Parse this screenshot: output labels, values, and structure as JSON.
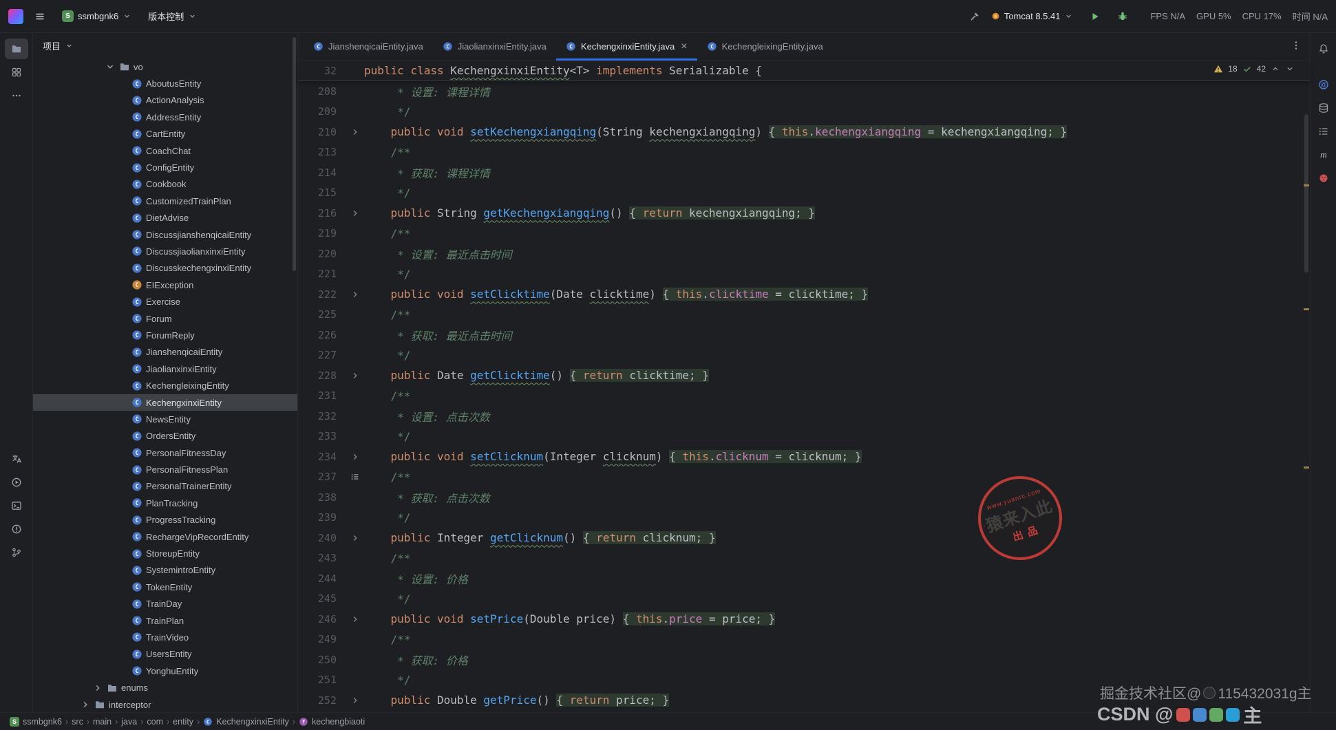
{
  "colors": {
    "accent": "#3574F0",
    "keyword": "#CF8E6D",
    "method": "#56A8F5",
    "field": "#C77DBB",
    "comment": "#5F826B",
    "warning": "#D6AE58",
    "selection": "#3E4146",
    "background": "#1E1F22"
  },
  "titlebar": {
    "project": {
      "initial": "S",
      "name": "ssmbgnk6"
    },
    "vcs_label": "版本控制",
    "run_config": "Tomcat 8.5.41",
    "perf": [
      "FPS N/A",
      "GPU 5%",
      "CPU 17%",
      "时间 N/A"
    ]
  },
  "left_rail": {
    "top": [
      {
        "name": "project",
        "icon": "folder",
        "active": true
      },
      {
        "name": "modules",
        "icon": "grid"
      },
      {
        "name": "more-tools",
        "icon": "more"
      }
    ],
    "bottom": [
      {
        "name": "translation",
        "icon": "translate"
      },
      {
        "name": "services",
        "icon": "services"
      },
      {
        "name": "terminal",
        "icon": "terminal"
      },
      {
        "name": "problems",
        "icon": "problems"
      },
      {
        "name": "version-control",
        "icon": "branch"
      }
    ]
  },
  "right_rail": {
    "top": [
      {
        "name": "notifications",
        "icon": "bell"
      }
    ],
    "items": [
      {
        "name": "ai-assistant",
        "icon": "at"
      },
      {
        "name": "database",
        "icon": "database"
      },
      {
        "name": "bookmarks",
        "icon": "lines"
      },
      {
        "name": "maven",
        "icon": "maven"
      },
      {
        "name": "plugin",
        "icon": "plugin"
      }
    ]
  },
  "sidebar": {
    "header_title": "项目",
    "tree": [
      {
        "label": "vo",
        "type": "folder",
        "level": 5,
        "expanded": true
      },
      {
        "label": "AboutusEntity",
        "type": "class",
        "level": 6
      },
      {
        "label": "ActionAnalysis",
        "type": "class",
        "level": 6
      },
      {
        "label": "AddressEntity",
        "type": "class",
        "level": 6
      },
      {
        "label": "CartEntity",
        "type": "class",
        "level": 6
      },
      {
        "label": "CoachChat",
        "type": "class",
        "level": 6
      },
      {
        "label": "ConfigEntity",
        "type": "class",
        "level": 6
      },
      {
        "label": "Cookbook",
        "type": "class",
        "level": 6
      },
      {
        "label": "CustomizedTrainPlan",
        "type": "class",
        "level": 6
      },
      {
        "label": "DietAdvise",
        "type": "class",
        "level": 6
      },
      {
        "label": "DiscussjianshenqicaiEntity",
        "type": "class",
        "level": 6
      },
      {
        "label": "DiscussjiaolianxinxiEntity",
        "type": "class",
        "level": 6
      },
      {
        "label": "DiscusskechengxinxiEntity",
        "type": "class",
        "level": 6
      },
      {
        "label": "EIException",
        "type": "class-exc",
        "level": 6
      },
      {
        "label": "Exercise",
        "type": "class",
        "level": 6
      },
      {
        "label": "Forum",
        "type": "class",
        "level": 6
      },
      {
        "label": "ForumReply",
        "type": "class",
        "level": 6
      },
      {
        "label": "JianshenqicaiEntity",
        "type": "class",
        "level": 6
      },
      {
        "label": "JiaolianxinxiEntity",
        "type": "class",
        "level": 6
      },
      {
        "label": "KechengleixingEntity",
        "type": "class",
        "level": 6
      },
      {
        "label": "KechengxinxiEntity",
        "type": "class",
        "level": 6,
        "selected": true
      },
      {
        "label": "NewsEntity",
        "type": "class",
        "level": 6
      },
      {
        "label": "OrdersEntity",
        "type": "class",
        "level": 6
      },
      {
        "label": "PersonalFitnessDay",
        "type": "class",
        "level": 6
      },
      {
        "label": "PersonalFitnessPlan",
        "type": "class",
        "level": 6
      },
      {
        "label": "PersonalTrainerEntity",
        "type": "class",
        "level": 6
      },
      {
        "label": "PlanTracking",
        "type": "class",
        "level": 6
      },
      {
        "label": "ProgressTracking",
        "type": "class",
        "level": 6
      },
      {
        "label": "RechargeVipRecordEntity",
        "type": "class",
        "level": 6
      },
      {
        "label": "StoreupEntity",
        "type": "class",
        "level": 6
      },
      {
        "label": "SystemintroEntity",
        "type": "class",
        "level": 6
      },
      {
        "label": "TokenEntity",
        "type": "class",
        "level": 6
      },
      {
        "label": "TrainDay",
        "type": "class",
        "level": 6
      },
      {
        "label": "TrainPlan",
        "type": "class",
        "level": 6
      },
      {
        "label": "TrainVideo",
        "type": "class",
        "level": 6
      },
      {
        "label": "UsersEntity",
        "type": "class",
        "level": 6
      },
      {
        "label": "YonghuEntity",
        "type": "class",
        "level": 6
      },
      {
        "label": "enums",
        "type": "folder",
        "level": 4
      },
      {
        "label": "interceptor",
        "type": "folder",
        "level": 3
      }
    ]
  },
  "editor": {
    "tabs": [
      {
        "label": "JianshenqicaiEntity.java"
      },
      {
        "label": "JiaolianxinxiEntity.java"
      },
      {
        "label": "KechengxinxiEntity.java",
        "active": true
      },
      {
        "label": "KechengleixingEntity.java"
      }
    ],
    "inspections": {
      "warnings": "18",
      "typos": "42"
    },
    "sticky": {
      "n": "32",
      "g": "",
      "t": [
        [
          "public",
          "k"
        ],
        [
          " ",
          "d"
        ],
        [
          "class",
          "k"
        ],
        [
          " ",
          "d"
        ],
        [
          "KechengxinxiEntity",
          "dw"
        ],
        [
          "<T> ",
          "d"
        ],
        [
          "implements",
          "k"
        ],
        [
          " Serializable {",
          "d"
        ]
      ]
    },
    "lines": [
      {
        "n": "208",
        "g": "",
        "t": [
          [
            "     * ",
            "c"
          ],
          [
            "设置: 课程详情",
            "ci"
          ]
        ]
      },
      {
        "n": "209",
        "g": "",
        "t": [
          [
            "     */",
            "c"
          ]
        ]
      },
      {
        "n": "210",
        "g": "a",
        "t": [
          [
            "    ",
            "d"
          ],
          [
            "public",
            "k"
          ],
          [
            " ",
            "d"
          ],
          [
            "void",
            "k"
          ],
          [
            " ",
            "d"
          ],
          [
            "setKechengxiangqing",
            "mw"
          ],
          [
            "(String ",
            "d"
          ],
          [
            "kechengxiangqing",
            "dw"
          ],
          [
            ") ",
            "d"
          ],
          [
            "{ ",
            "d",
            1
          ],
          [
            "this",
            "k",
            1
          ],
          [
            ".",
            "d",
            1
          ],
          [
            "kechengxiangqing",
            "f",
            1
          ],
          [
            " = kechengxiangqing; ",
            "d",
            1
          ],
          [
            "}",
            "d",
            1
          ]
        ]
      },
      {
        "n": "213",
        "g": "",
        "t": [
          [
            "    /**",
            "c"
          ]
        ]
      },
      {
        "n": "214",
        "g": "",
        "t": [
          [
            "     * ",
            "c"
          ],
          [
            "获取: 课程详情",
            "ci"
          ]
        ]
      },
      {
        "n": "215",
        "g": "",
        "t": [
          [
            "     */",
            "c"
          ]
        ]
      },
      {
        "n": "216",
        "g": "a",
        "t": [
          [
            "    ",
            "d"
          ],
          [
            "public",
            "k"
          ],
          [
            " String ",
            "d"
          ],
          [
            "getKechengxiangqing",
            "mw"
          ],
          [
            "() ",
            "d"
          ],
          [
            "{ ",
            "d",
            1
          ],
          [
            "return",
            "k",
            1
          ],
          [
            " kechengxiangqing; ",
            "d",
            1
          ],
          [
            "}",
            "d",
            1
          ]
        ]
      },
      {
        "n": "219",
        "g": "",
        "t": [
          [
            "    /**",
            "c"
          ]
        ]
      },
      {
        "n": "220",
        "g": "",
        "t": [
          [
            "     * ",
            "c"
          ],
          [
            "设置: 最近点击时间",
            "ci"
          ]
        ]
      },
      {
        "n": "221",
        "g": "",
        "t": [
          [
            "     */",
            "c"
          ]
        ]
      },
      {
        "n": "222",
        "g": "a",
        "t": [
          [
            "    ",
            "d"
          ],
          [
            "public",
            "k"
          ],
          [
            " ",
            "d"
          ],
          [
            "void",
            "k"
          ],
          [
            " ",
            "d"
          ],
          [
            "setClicktime",
            "mw"
          ],
          [
            "(Date ",
            "d"
          ],
          [
            "clicktime",
            "dw"
          ],
          [
            ") ",
            "d"
          ],
          [
            "{ ",
            "d",
            1
          ],
          [
            "this",
            "k",
            1
          ],
          [
            ".",
            "d",
            1
          ],
          [
            "clicktime",
            "f",
            1
          ],
          [
            " = clicktime; ",
            "d",
            1
          ],
          [
            "}",
            "d",
            1
          ]
        ]
      },
      {
        "n": "225",
        "g": "",
        "t": [
          [
            "    /**",
            "c"
          ]
        ]
      },
      {
        "n": "226",
        "g": "",
        "t": [
          [
            "     * ",
            "c"
          ],
          [
            "获取: 最近点击时间",
            "ci"
          ]
        ]
      },
      {
        "n": "227",
        "g": "",
        "t": [
          [
            "     */",
            "c"
          ]
        ]
      },
      {
        "n": "228",
        "g": "a",
        "t": [
          [
            "    ",
            "d"
          ],
          [
            "public",
            "k"
          ],
          [
            " Date ",
            "d"
          ],
          [
            "getClicktime",
            "mw"
          ],
          [
            "() ",
            "d"
          ],
          [
            "{ ",
            "d",
            1
          ],
          [
            "return",
            "k",
            1
          ],
          [
            " clicktime; ",
            "d",
            1
          ],
          [
            "}",
            "d",
            1
          ]
        ]
      },
      {
        "n": "231",
        "g": "",
        "t": [
          [
            "    /**",
            "c"
          ]
        ]
      },
      {
        "n": "232",
        "g": "",
        "t": [
          [
            "     * ",
            "c"
          ],
          [
            "设置: 点击次数",
            "ci"
          ]
        ]
      },
      {
        "n": "233",
        "g": "",
        "t": [
          [
            "     */",
            "c"
          ]
        ]
      },
      {
        "n": "234",
        "g": "a",
        "t": [
          [
            "    ",
            "d"
          ],
          [
            "public",
            "k"
          ],
          [
            " ",
            "d"
          ],
          [
            "void",
            "k"
          ],
          [
            " ",
            "d"
          ],
          [
            "setClicknum",
            "mw"
          ],
          [
            "(Integer ",
            "d"
          ],
          [
            "clicknum",
            "dw"
          ],
          [
            ") ",
            "d"
          ],
          [
            "{ ",
            "d",
            1
          ],
          [
            "this",
            "k",
            1
          ],
          [
            ".",
            "d",
            1
          ],
          [
            "clicknum",
            "f",
            1
          ],
          [
            " = clicknum; ",
            "d",
            1
          ],
          [
            "}",
            "d",
            1
          ]
        ]
      },
      {
        "n": "237",
        "g": "b",
        "t": [
          [
            "    /**",
            "c"
          ]
        ]
      },
      {
        "n": "238",
        "g": "",
        "t": [
          [
            "     * ",
            "c"
          ],
          [
            "获取: 点击次数",
            "ci"
          ]
        ]
      },
      {
        "n": "239",
        "g": "",
        "t": [
          [
            "     */",
            "c"
          ]
        ]
      },
      {
        "n": "240",
        "g": "a",
        "t": [
          [
            "    ",
            "d"
          ],
          [
            "public",
            "k"
          ],
          [
            " Integer ",
            "d"
          ],
          [
            "getClicknum",
            "mw"
          ],
          [
            "() ",
            "d"
          ],
          [
            "{ ",
            "d",
            1
          ],
          [
            "return",
            "k",
            1
          ],
          [
            " clicknum; ",
            "d",
            1
          ],
          [
            "}",
            "d",
            1
          ]
        ]
      },
      {
        "n": "243",
        "g": "",
        "t": [
          [
            "    /**",
            "c"
          ]
        ]
      },
      {
        "n": "244",
        "g": "",
        "t": [
          [
            "     * ",
            "c"
          ],
          [
            "设置: 价格",
            "ci"
          ]
        ]
      },
      {
        "n": "245",
        "g": "",
        "t": [
          [
            "     */",
            "c"
          ]
        ]
      },
      {
        "n": "246",
        "g": "a",
        "t": [
          [
            "    ",
            "d"
          ],
          [
            "public",
            "k"
          ],
          [
            " ",
            "d"
          ],
          [
            "void",
            "k"
          ],
          [
            " ",
            "d"
          ],
          [
            "setPrice",
            "m"
          ],
          [
            "(Double price) ",
            "d"
          ],
          [
            "{ ",
            "d",
            1
          ],
          [
            "this",
            "k",
            1
          ],
          [
            ".",
            "d",
            1
          ],
          [
            "price",
            "f",
            1
          ],
          [
            " = price; ",
            "d",
            1
          ],
          [
            "}",
            "d",
            1
          ]
        ]
      },
      {
        "n": "249",
        "g": "",
        "t": [
          [
            "    /**",
            "c"
          ]
        ]
      },
      {
        "n": "250",
        "g": "",
        "t": [
          [
            "     * ",
            "c"
          ],
          [
            "获取: 价格",
            "ci"
          ]
        ]
      },
      {
        "n": "251",
        "g": "",
        "t": [
          [
            "     */",
            "c"
          ]
        ]
      },
      {
        "n": "252",
        "g": "a",
        "t": [
          [
            "    ",
            "d"
          ],
          [
            "public",
            "k"
          ],
          [
            " Double ",
            "d"
          ],
          [
            "getPrice",
            "m"
          ],
          [
            "() ",
            "d"
          ],
          [
            "{ ",
            "d",
            1
          ],
          [
            "return",
            "k",
            1
          ],
          [
            " price; ",
            "d",
            1
          ],
          [
            "}",
            "d",
            1
          ]
        ]
      }
    ]
  },
  "statusbar": {
    "badge_initial": "S",
    "crumbs": [
      {
        "label": "ssmbgnk6",
        "icon": "project-badge"
      },
      {
        "label": "src"
      },
      {
        "label": "main"
      },
      {
        "label": "java"
      },
      {
        "label": "com"
      },
      {
        "label": "entity"
      },
      {
        "label": "KechengxinxiEntity",
        "icon": "class"
      },
      {
        "label": "kechengbiaoti",
        "icon": "field"
      }
    ]
  },
  "watermarks": {
    "stamp": {
      "url": "www.yuanrc.com",
      "main": "猿来入此",
      "sub": "出品"
    },
    "juejin_prefix": "掘金技术社区@",
    "juejin_suffix": "115432031g主",
    "csdn_prefix": "CSDN @",
    "csdn_suffix": "主",
    "csdn_icon_colors": [
      "#D9534F",
      "#4A90D9",
      "#67B168",
      "#2AA5E0"
    ]
  }
}
